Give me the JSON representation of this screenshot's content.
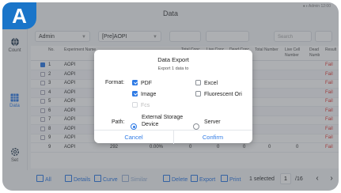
{
  "badge": "A",
  "window": {
    "title": "Data",
    "status": "●◑ Admin 12:00"
  },
  "sidebar": {
    "items": [
      {
        "label": "Count",
        "icon": "globe-icon"
      },
      {
        "label": "Data",
        "icon": "grid-icon"
      },
      {
        "label": "Set",
        "icon": "gear-icon"
      }
    ]
  },
  "toolbar": {
    "user_select": "Admin",
    "experiment_select": "[Pre]AOPI",
    "search_placeholder": "Search"
  },
  "table": {
    "columns": [
      "No.",
      "Experiment Name",
      "Total Conc",
      "Live Conc",
      "Dead Conc",
      "Total Number",
      "Live Cell Number",
      "Dead Numb",
      "Result"
    ],
    "rows": [
      {
        "no": "1",
        "name": "AOPI",
        "result": "Fail",
        "checked": true
      },
      {
        "no": "2",
        "name": "AOPI",
        "result": "Fail",
        "checked": false
      },
      {
        "no": "3",
        "name": "AOPI",
        "result": "Fail",
        "checked": false
      },
      {
        "no": "4",
        "name": "AOPI",
        "result": "Fail",
        "checked": false
      },
      {
        "no": "5",
        "name": "AOPI",
        "result": "Fail",
        "checked": false
      },
      {
        "no": "6",
        "name": "AOPI",
        "result": "Fail",
        "checked": false
      },
      {
        "no": "7",
        "name": "AOPI",
        "result": "Fail",
        "checked": false
      },
      {
        "no": "8",
        "name": "AOPI",
        "result": "Fail",
        "checked": false
      },
      {
        "no": "9",
        "name": "AOPI",
        "result": "Fail",
        "checked": false
      }
    ],
    "last_row": {
      "no": "9",
      "name": "AOPI",
      "v1": "292",
      "v2": "0.00%",
      "v3": "0",
      "v4": "0",
      "v5": "0",
      "v6": "0",
      "v7": "0",
      "result": "Fail"
    }
  },
  "bottombar": {
    "all": "All",
    "details": "Details",
    "curve": "Curve",
    "similar": "Similar",
    "delete": "Delete",
    "export": "Export",
    "print": "Print",
    "selected": "1 selected",
    "page": "1",
    "total_pages": "/16"
  },
  "dialog": {
    "title": "Data Export",
    "subtitle": "Export 1 data to",
    "format_label": "Format:",
    "formats": [
      {
        "label": "PDF",
        "checked": true,
        "disabled": false
      },
      {
        "label": "Excel",
        "checked": false,
        "disabled": false
      },
      {
        "label": "Image",
        "checked": true,
        "disabled": false
      },
      {
        "label": "Fluorescent Ori",
        "checked": false,
        "disabled": false
      },
      {
        "label": "Fcs",
        "checked": false,
        "disabled": true
      }
    ],
    "path_label": "Path:",
    "paths": [
      {
        "label": "External Storage Device",
        "selected": true
      },
      {
        "label": "Server",
        "selected": false
      }
    ],
    "cancel": "Cancel",
    "confirm": "Confirm"
  },
  "colors": {
    "accent": "#2f7be5",
    "badge": "#1a75c9",
    "fail": "#e53935"
  }
}
